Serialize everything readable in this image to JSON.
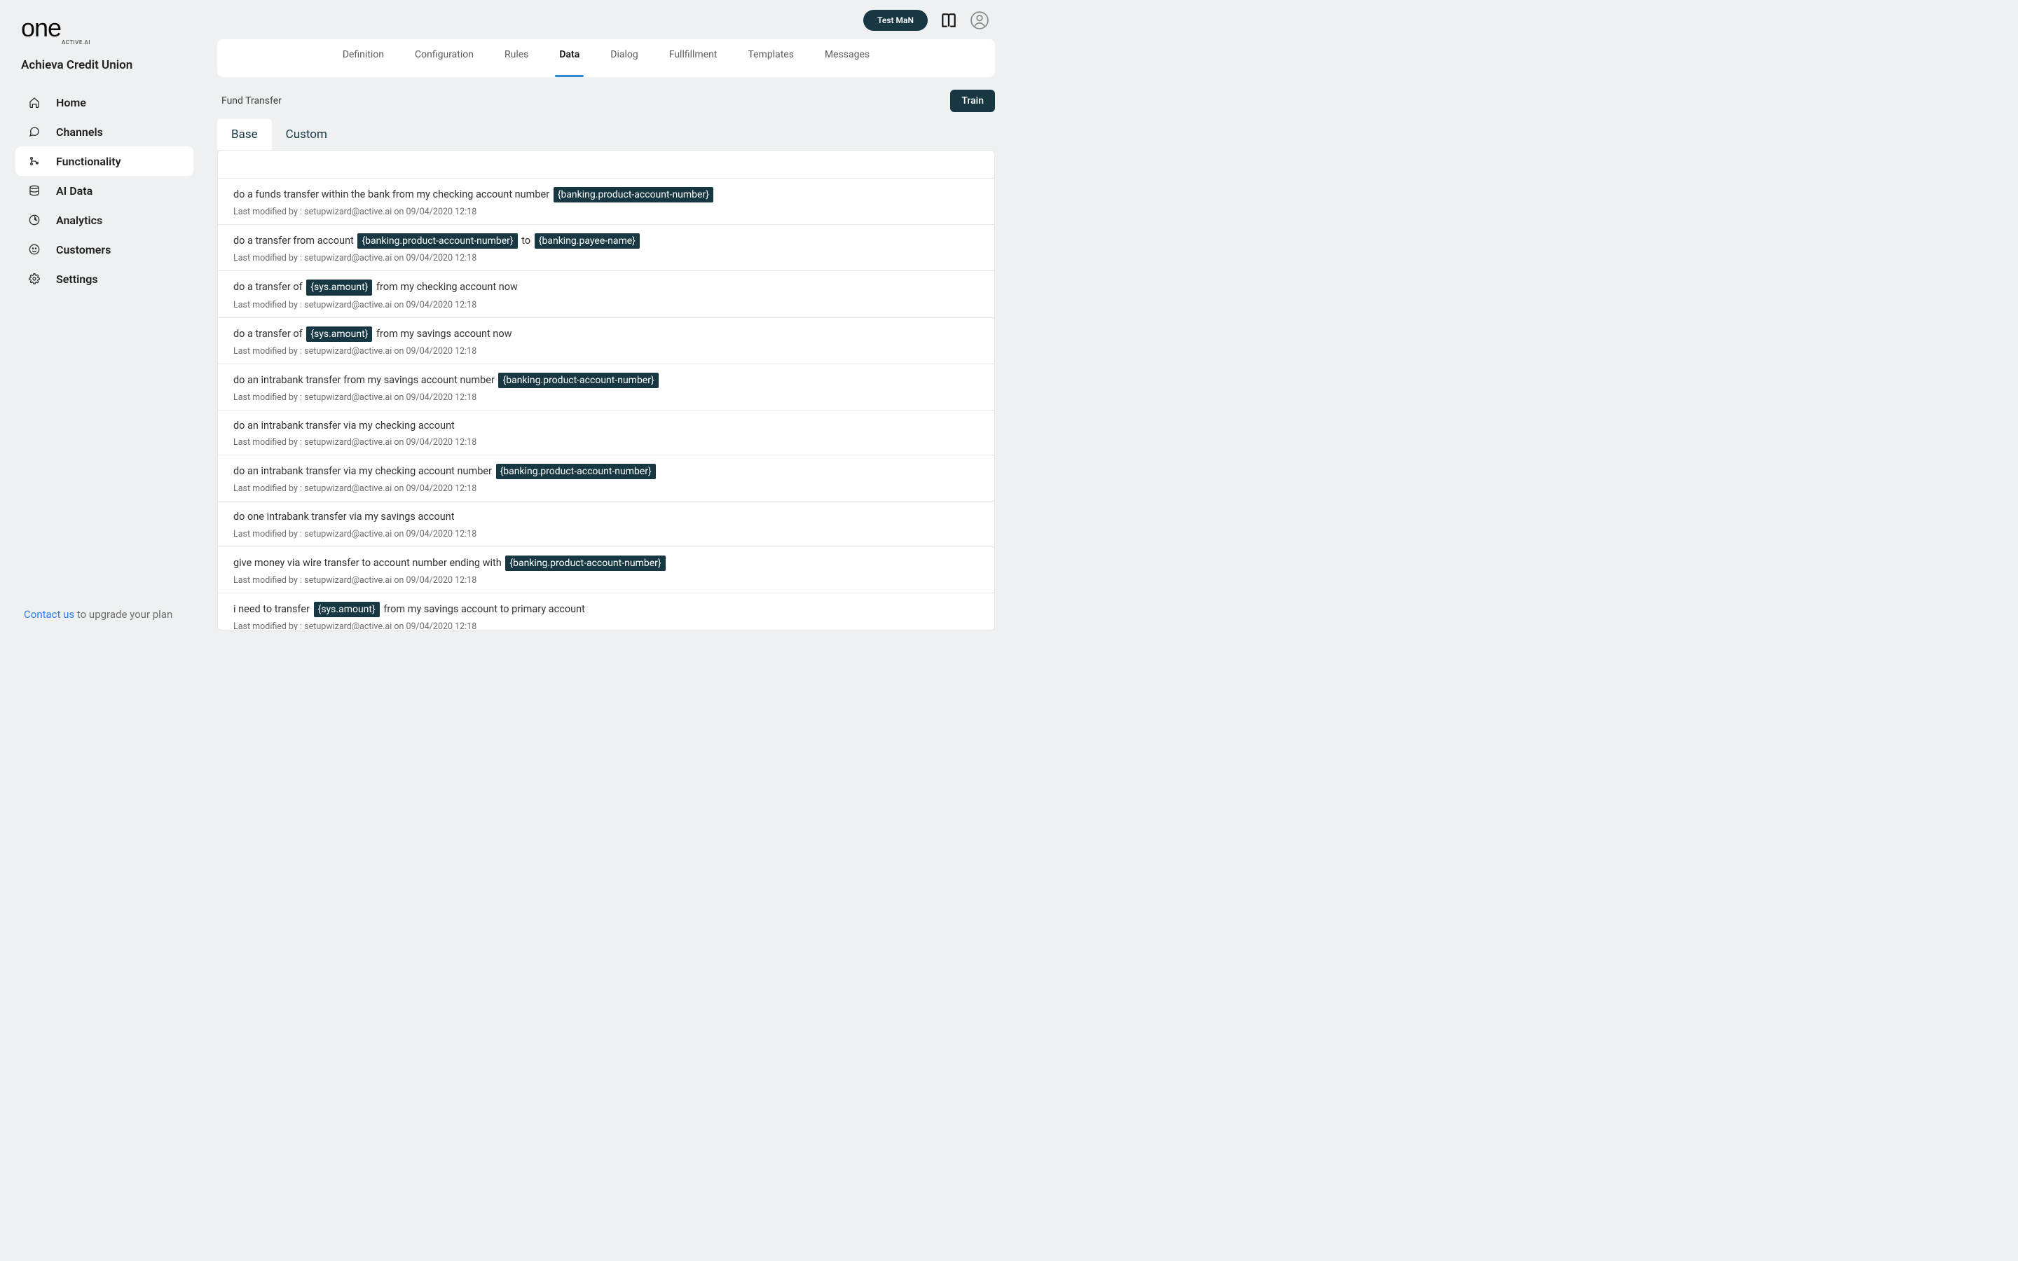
{
  "brand": {
    "name": "one",
    "subtitle": "ACTIVE.AI"
  },
  "org": {
    "name": "Achieva Credit Union"
  },
  "sidebar": {
    "items": [
      {
        "label": "Home"
      },
      {
        "label": "Channels"
      },
      {
        "label": "Functionality"
      },
      {
        "label": "AI Data"
      },
      {
        "label": "Analytics"
      },
      {
        "label": "Customers"
      },
      {
        "label": "Settings"
      }
    ]
  },
  "topbar": {
    "account_badge": "Test MaN"
  },
  "tabs": [
    {
      "label": "Definition"
    },
    {
      "label": "Configuration"
    },
    {
      "label": "Rules"
    },
    {
      "label": "Data"
    },
    {
      "label": "Dialog"
    },
    {
      "label": "Fullfillment"
    },
    {
      "label": "Templates"
    },
    {
      "label": "Messages"
    }
  ],
  "page": {
    "breadcrumb": "Fund Transfer",
    "train_label": "Train"
  },
  "subtabs": [
    {
      "label": "Base"
    },
    {
      "label": "Custom"
    }
  ],
  "rows": [
    {
      "meta": "Last modified by : setupwizard@active.ai on 09/04/2020 12:18",
      "segments": [
        {
          "t": "do a funds transfer within the bank from my checking account number "
        },
        {
          "chip": "{banking.product-account-number}"
        }
      ]
    },
    {
      "meta": "Last modified by : setupwizard@active.ai on 09/04/2020 12:18",
      "segments": [
        {
          "t": "do a transfer from account "
        },
        {
          "chip": "{banking.product-account-number}"
        },
        {
          "t": " to "
        },
        {
          "chip": "{banking.payee-name}"
        }
      ]
    },
    {
      "meta": "Last modified by : setupwizard@active.ai on 09/04/2020 12:18",
      "segments": [
        {
          "t": "do a transfer of "
        },
        {
          "chip": "{sys.amount}"
        },
        {
          "t": " from my checking account now"
        }
      ]
    },
    {
      "meta": "Last modified by : setupwizard@active.ai on 09/04/2020 12:18",
      "segments": [
        {
          "t": "do a transfer of "
        },
        {
          "chip": "{sys.amount}"
        },
        {
          "t": " from my savings account now"
        }
      ]
    },
    {
      "meta": "Last modified by : setupwizard@active.ai on 09/04/2020 12:18",
      "segments": [
        {
          "t": "do an intrabank transfer from my savings account number "
        },
        {
          "chip": "{banking.product-account-number}"
        }
      ]
    },
    {
      "meta": "Last modified by : setupwizard@active.ai on 09/04/2020 12:18",
      "segments": [
        {
          "t": "do an intrabank transfer via my checking account"
        }
      ]
    },
    {
      "meta": "Last modified by : setupwizard@active.ai on 09/04/2020 12:18",
      "segments": [
        {
          "t": "do an intrabank transfer via my checking account number "
        },
        {
          "chip": "{banking.product-account-number}"
        }
      ]
    },
    {
      "meta": "Last modified by : setupwizard@active.ai on 09/04/2020 12:18",
      "segments": [
        {
          "t": "do one intrabank transfer via my savings account"
        }
      ]
    },
    {
      "meta": "Last modified by : setupwizard@active.ai on 09/04/2020 12:18",
      "segments": [
        {
          "t": "give money via wire transfer to account number ending with "
        },
        {
          "chip": "{banking.product-account-number}"
        }
      ]
    },
    {
      "meta": "Last modified by : setupwizard@active.ai on 09/04/2020 12:18",
      "segments": [
        {
          "t": "i need to transfer "
        },
        {
          "chip": "{sys.amount}"
        },
        {
          "t": " from my savings account to primary account"
        }
      ]
    }
  ],
  "footer": {
    "contact": "Contact us",
    "rest": " to upgrade your plan"
  }
}
